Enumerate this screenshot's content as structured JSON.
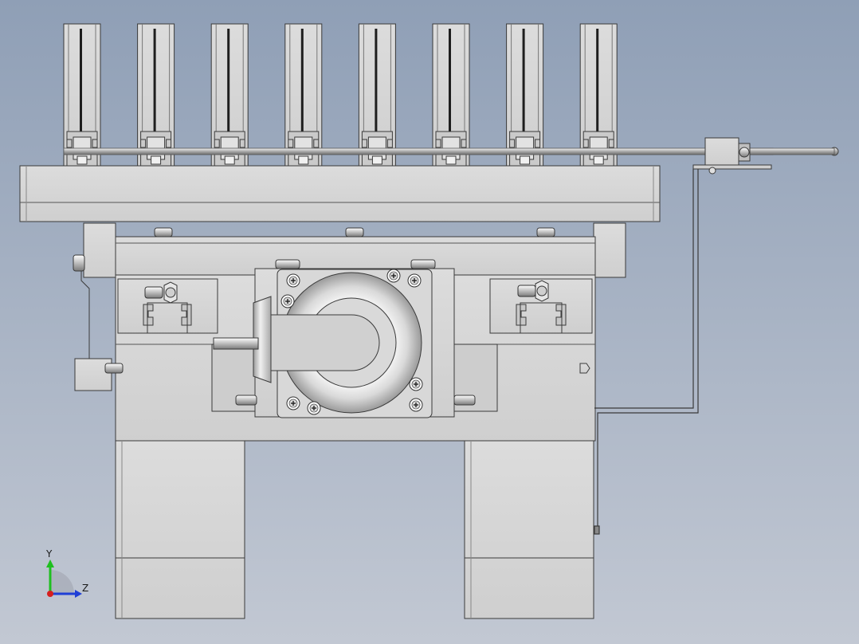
{
  "viewport": {
    "background_top": "#8f9fb6",
    "background_bottom": "#c2c8d3"
  },
  "model": {
    "part_fill": "#d4d4d4",
    "part_shade": "#bdbdbd",
    "edge_color": "#3a3a3a",
    "steel_light": "#f2f2f2",
    "steel_dark": "#8c8c8c",
    "column_count": 8,
    "screws": [
      "phillips-screw-icon",
      "hex-nut-icon"
    ]
  },
  "triad": {
    "y_label": "Y",
    "z_label": "Z",
    "y_color": "#1fbf1f",
    "z_color": "#1f3fd6",
    "x_color": "#d61f1f"
  }
}
